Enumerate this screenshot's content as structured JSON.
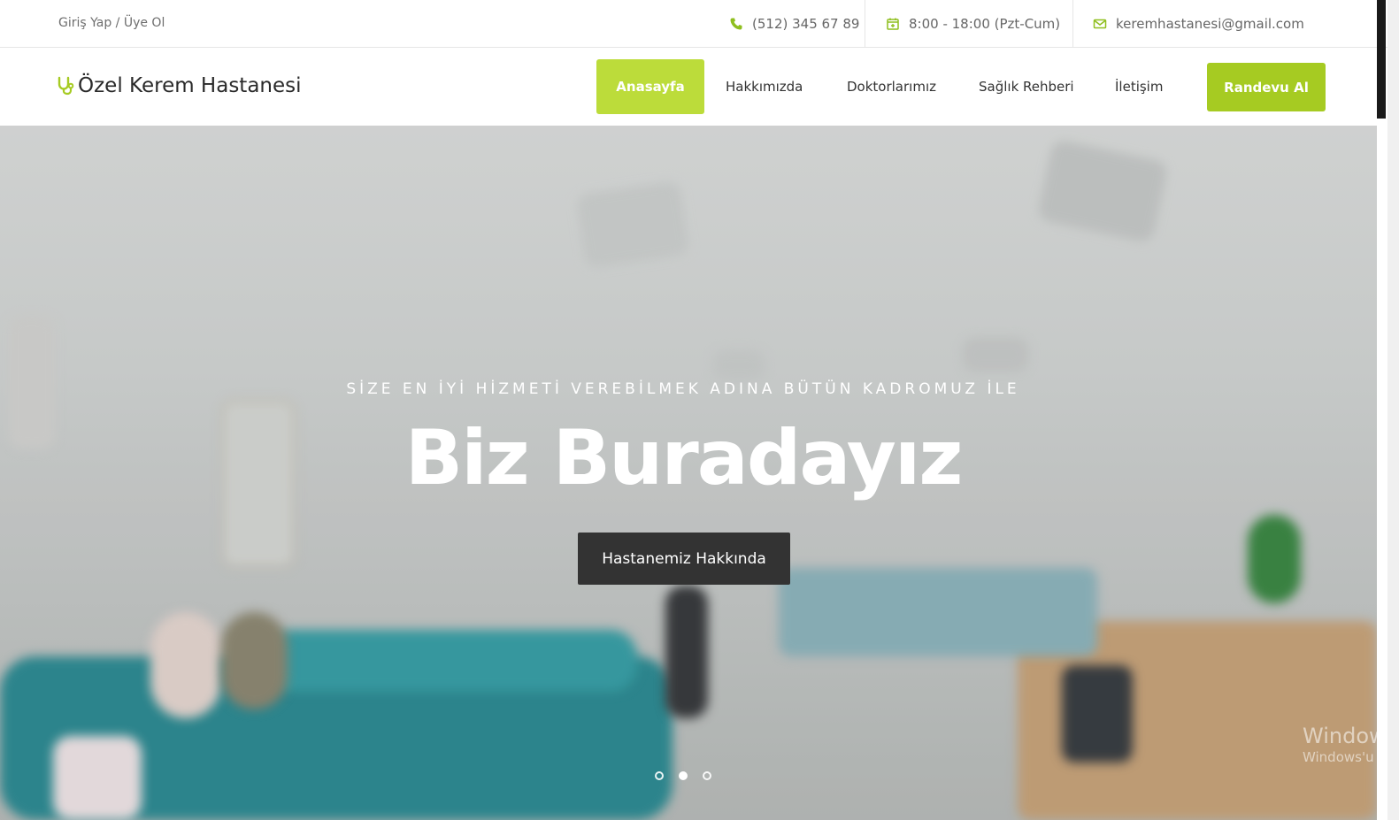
{
  "topbar": {
    "login_text": "Giriş Yap / Üye Ol",
    "phone": "(512) 345 67 89",
    "hours": "8:00 - 18:00 (Pzt-Cum)",
    "email": "keremhastanesi@gmail.com"
  },
  "nav": {
    "brand": "Özel Kerem Hastanesi",
    "items": [
      "Anasayfa",
      "Hakkımızda",
      "Doktorlarımız",
      "Sağlık Rehberi",
      "İletişim"
    ],
    "cta": "Randevu Al"
  },
  "hero": {
    "subtitle": "SİZE EN İYİ HİZMETİ VEREBİLMEK ADINA BÜTÜN KADROMUZ İLE",
    "title": "Biz Buradayız",
    "button": "Hastanemiz Hakkında",
    "slide_count": 3,
    "active_slide": 2
  },
  "watermark": {
    "line1": "Windows",
    "line2": "Windows'u"
  },
  "colors": {
    "accent": "#bcdc3a",
    "cta": "#a6cb22",
    "dark_button": "#333333"
  }
}
